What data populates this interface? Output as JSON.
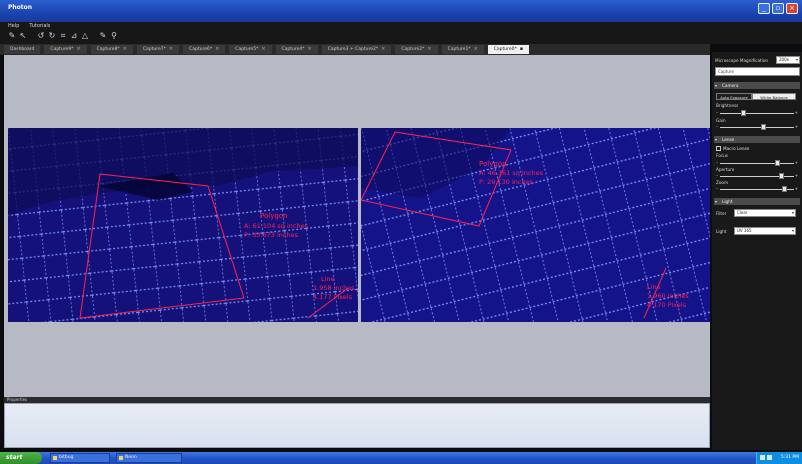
{
  "window": {
    "title": "Photon"
  },
  "menu": {
    "items": [
      "Help",
      "Tutorials"
    ]
  },
  "toolbar": {
    "icons": [
      "pencil-icon",
      "cursor-icon",
      "undo-icon",
      "redo-icon",
      "crop-icon",
      "ruler-icon",
      "measure-icon",
      "pencil2-icon",
      "zoom-icon"
    ]
  },
  "tabs": [
    {
      "label": "Dashboard"
    },
    {
      "label": "Capture9*"
    },
    {
      "label": "Capture8*"
    },
    {
      "label": "Capture7*"
    },
    {
      "label": "Capture6*"
    },
    {
      "label": "Capture5*"
    },
    {
      "label": "Capture4*"
    },
    {
      "label": "Capture3 + Capture2*"
    },
    {
      "label": "Capture2*"
    },
    {
      "label": "Capture1*"
    },
    {
      "label": "Capture0*"
    }
  ],
  "viewer": {
    "left_annotations": [
      "Polygon",
      "A: 61.104 sq inches",
      "P: 33.673 inches",
      "Line",
      "1.958 inches",
      "4.177 Pixels"
    ],
    "right_annotations": [
      "Polygon",
      "A: 46.361 sq inches",
      "P: 29.130 inches",
      "Line",
      "1.960 inches",
      "4.170 Pixels"
    ],
    "palette": {
      "background": "#10106a",
      "grid": "#7f9cff",
      "annotation": "#ff2050"
    }
  },
  "properties": {
    "label": "Properties"
  },
  "right_panel": {
    "magnification_label": "Microscope Magnification",
    "magnification_value": "200x",
    "capture_button": "Capture",
    "camera": {
      "title": "Camera",
      "auto_exposure": "Auto Exposure",
      "white_balance": "White Balance",
      "brightness_label": "Brightness",
      "brightness_level": 0.3,
      "gain_label": "Gain",
      "gain_level": 0.6
    },
    "lense": {
      "title": "Lense",
      "macro_lense": "Macro Lense",
      "focus_label": "Focus",
      "focus_level": 0.8,
      "aperture_label": "Aperture",
      "aperture_level": 0.85,
      "zoom_label": "Zoom",
      "zoom_level": 0.9
    },
    "light": {
      "title": "Light",
      "filter_label": "Filter",
      "filter_value": "Clear",
      "light_label": "Light",
      "light_value": "UV 365"
    }
  },
  "taskbar": {
    "start": "start",
    "tasks": [
      "bitbug",
      "Neon"
    ],
    "clock": "5:31 PM"
  }
}
